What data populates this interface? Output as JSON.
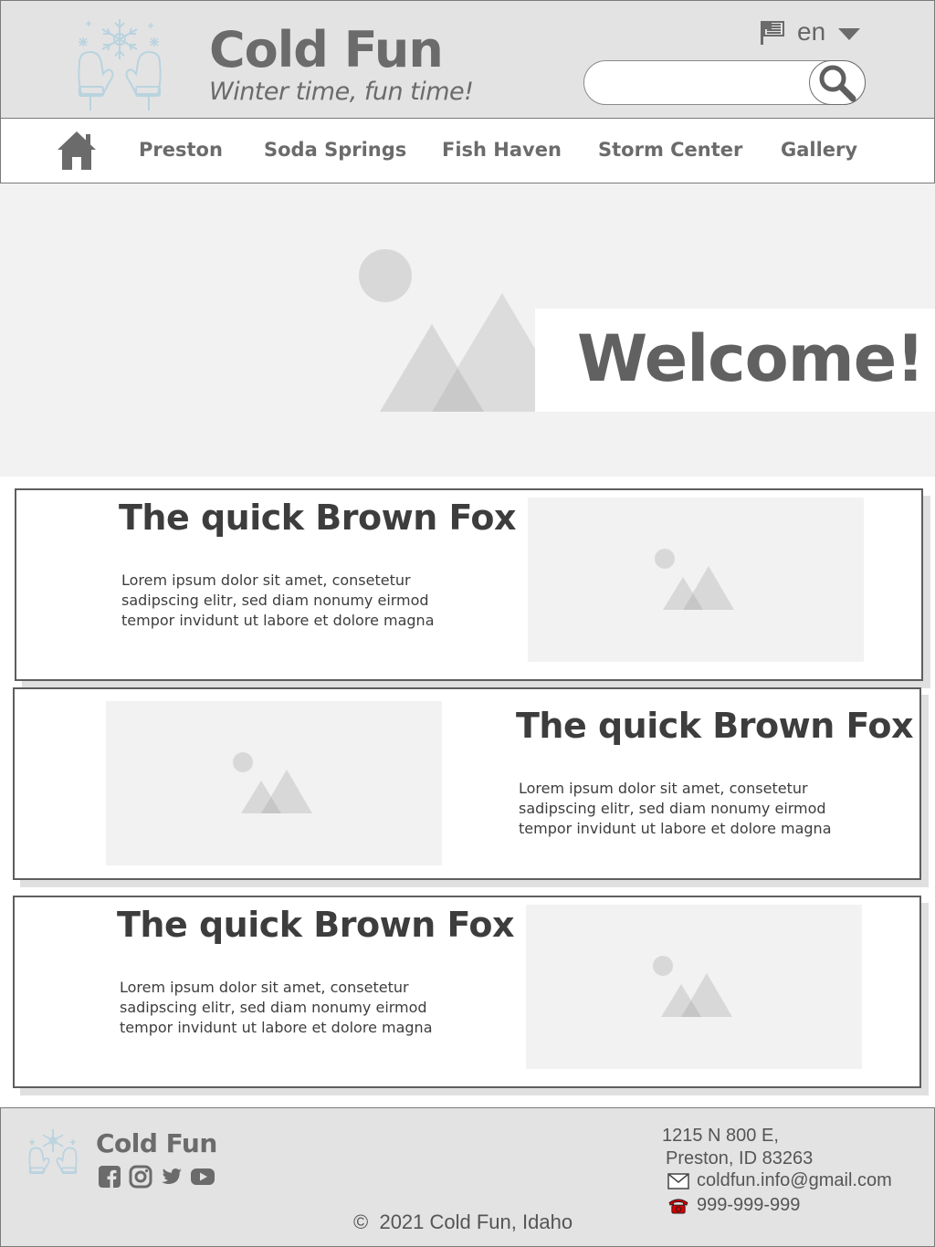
{
  "header": {
    "brand": "Cold Fun",
    "tagline": "Winter time, fun time!",
    "language": "en",
    "search": {
      "placeholder": "",
      "value": ""
    }
  },
  "nav": {
    "items": [
      {
        "label": "Preston"
      },
      {
        "label": "Soda Springs"
      },
      {
        "label": "Fish Haven"
      },
      {
        "label": "Storm Center"
      },
      {
        "label": "Gallery"
      }
    ]
  },
  "hero": {
    "heading": "Welcome!"
  },
  "cards": [
    {
      "title": "The quick Brown Fox",
      "body": "Lorem ipsum dolor sit amet, consetetur sadipscing elitr, sed diam nonumy eirmod tempor invidunt ut labore et dolore magna"
    },
    {
      "title": "The quick Brown Fox",
      "body": "Lorem ipsum dolor sit amet, consetetur sadipscing elitr, sed diam nonumy eirmod tempor invidunt ut labore et dolore magna"
    },
    {
      "title": "The quick Brown Fox",
      "body": "Lorem ipsum dolor sit amet, consetetur sadipscing elitr, sed diam nonumy eirmod tempor invidunt ut labore et dolore magna"
    }
  ],
  "footer": {
    "brand": "Cold Fun",
    "address_line1": "1215 N 800 E,",
    "address_line2": "Preston, ID 83263",
    "email": "coldfun.info@gmail.com",
    "phone": "999-999-999",
    "copyright_symbol": "©",
    "copyright": "2021 Cold Fun, Idaho",
    "social": [
      "facebook-icon",
      "instagram-icon",
      "twitter-icon",
      "youtube-icon"
    ]
  },
  "colors": {
    "header_bg": "#e3e3e3",
    "hero_bg": "#f2f2f2",
    "text_gray": "#6b6b6b",
    "logo_blue": "#b9d3df",
    "phone_red": "#d40000"
  }
}
